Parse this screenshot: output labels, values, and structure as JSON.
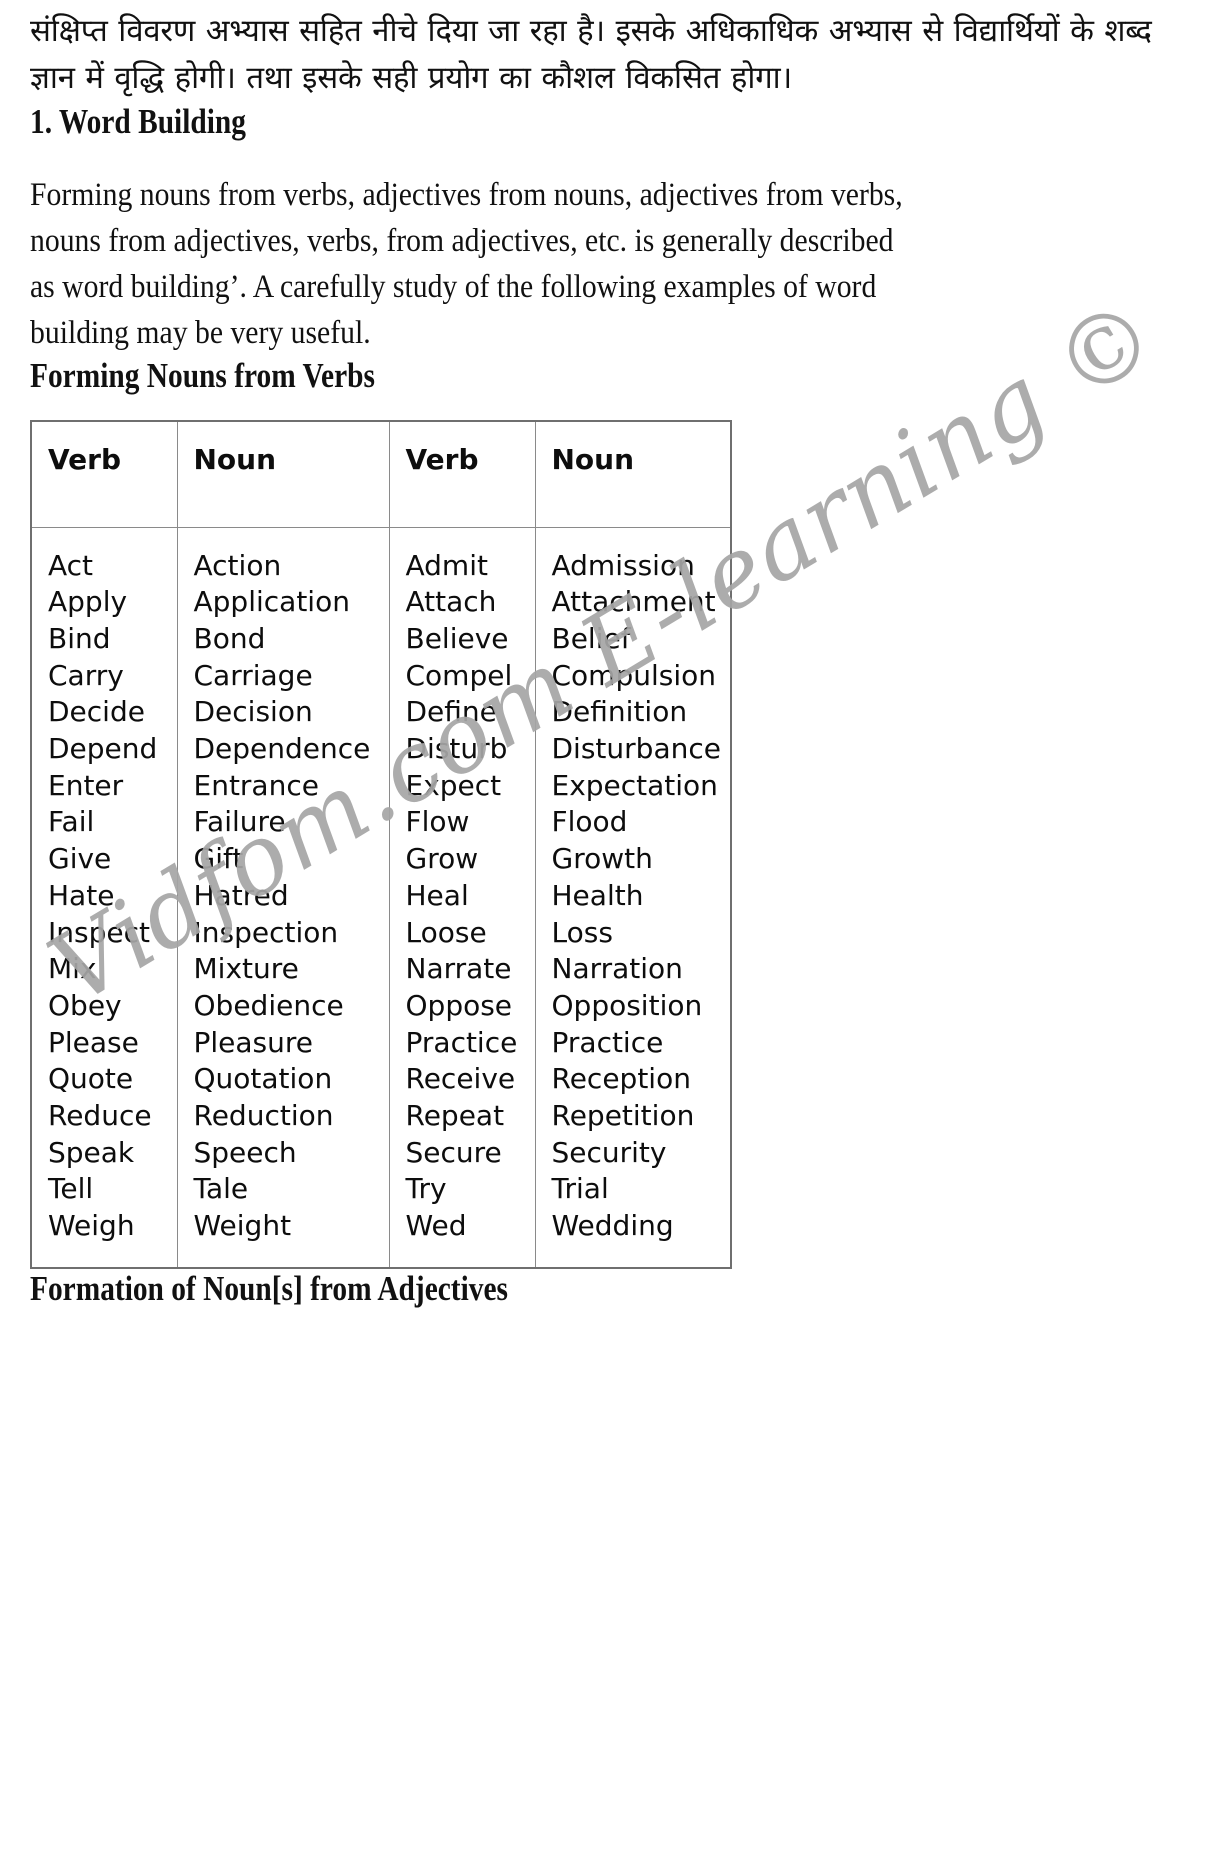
{
  "document": {
    "hindi_intro": "संक्षिप्त विवरण अभ्यास सहित नीचे दिया जा रहा है। इसके अधिकाधिक अभ्यास से विद्यार्थियों के शब्द ज्ञान में वृद्धि होगी। तथा इसके सही प्रयोग का कौशल विकसित होगा।",
    "heading_word_building": "1. Word Building",
    "body_paragraph": "Forming nouns from verbs, adjectives from nouns, adjectives from verbs, nouns from adjectives, verbs, from adjectives, etc. is generally described as word building’. A carefully study of the following examples of word building may be very useful.",
    "heading_forming_nouns": "Forming Nouns from Verbs",
    "heading_formation_adjectives": "Formation of Noun[s] from Adjectives",
    "watermark": "Vidfom.com E-learning ©",
    "watermark_color": "#a6a6a6"
  },
  "table": {
    "headers": [
      "Verb",
      "Noun",
      "Verb",
      "Noun"
    ],
    "columns": {
      "verb_1": [
        "Act",
        "Apply",
        "Bind",
        "Carry",
        "Decide",
        "Depend",
        "Enter",
        "Fail",
        "Give",
        "Hate",
        "Inspect",
        "Mix",
        "Obey",
        "Please",
        "Quote",
        "Reduce",
        "Speak",
        "Tell",
        "Weigh"
      ],
      "noun_1": [
        "Action",
        "Application",
        "Bond",
        "Carriage",
        "Decision",
        "Dependence",
        "Entrance",
        "Failure",
        "Gift",
        "Hatred",
        "Inspection",
        "Mixture",
        "Obedience",
        "Pleasure",
        "Quotation",
        "Reduction",
        "Speech",
        "Tale",
        "Weight"
      ],
      "verb_2": [
        "Admit",
        "Attach",
        "Believe",
        "Compel",
        "Define",
        "Disturb",
        "Expect",
        "Flow",
        "Grow",
        "Heal",
        "Loose",
        "Narrate",
        "Oppose",
        "Practice",
        "Receive",
        "Repeat",
        "Secure",
        "Try",
        "Wed"
      ],
      "noun_2": [
        "Admission",
        "Attachment",
        "Belief",
        "Compulsion",
        "Definition",
        "Disturbance",
        "Expectation",
        "Flood",
        "Growth",
        "Health",
        "Loss",
        "Narration",
        "Opposition",
        "Practice",
        "Reception",
        "Repetition",
        "Security",
        "Trial",
        "Wedding"
      ]
    },
    "pairs": [
      [
        "Act",
        "Action",
        "Admit",
        "Admission"
      ],
      [
        "Apply",
        "Application",
        "Attach",
        "Attachment"
      ],
      [
        "Bind",
        "Bond",
        "Believe",
        "Belief"
      ],
      [
        "Carry",
        "Carriage",
        "Compel",
        "Compulsion"
      ],
      [
        "Decide",
        "Decision",
        "Define",
        "Definition"
      ],
      [
        "Depend",
        "Dependence",
        "Disturb",
        "Disturbance"
      ],
      [
        "Enter",
        "Entrance",
        "Expect",
        "Expectation"
      ],
      [
        "Fail",
        "Failure",
        "Flow",
        "Flood"
      ],
      [
        "Give",
        "Gift",
        "Grow",
        "Growth"
      ],
      [
        "Hate",
        "Hatred",
        "Heal",
        "Health"
      ],
      [
        "Inspect",
        "Inspection",
        "Loose",
        "Loss"
      ],
      [
        "Mix",
        "Mixture",
        "Narrate",
        "Narration"
      ],
      [
        "Obey",
        "Obedience",
        "Oppose",
        "Opposition"
      ],
      [
        "Please",
        "Pleasure",
        "Practice",
        "Practice"
      ],
      [
        "Quote",
        "Quotation",
        "Receive",
        "Reception"
      ],
      [
        "Reduce",
        "Reduction",
        "Repeat",
        "Repetition"
      ],
      [
        "Speak",
        "Speech",
        "Secure",
        "Security"
      ],
      [
        "Tell",
        "Tale",
        "Try",
        "Trial"
      ],
      [
        "Weigh",
        "Weight",
        "Wed",
        "Wedding"
      ]
    ]
  }
}
